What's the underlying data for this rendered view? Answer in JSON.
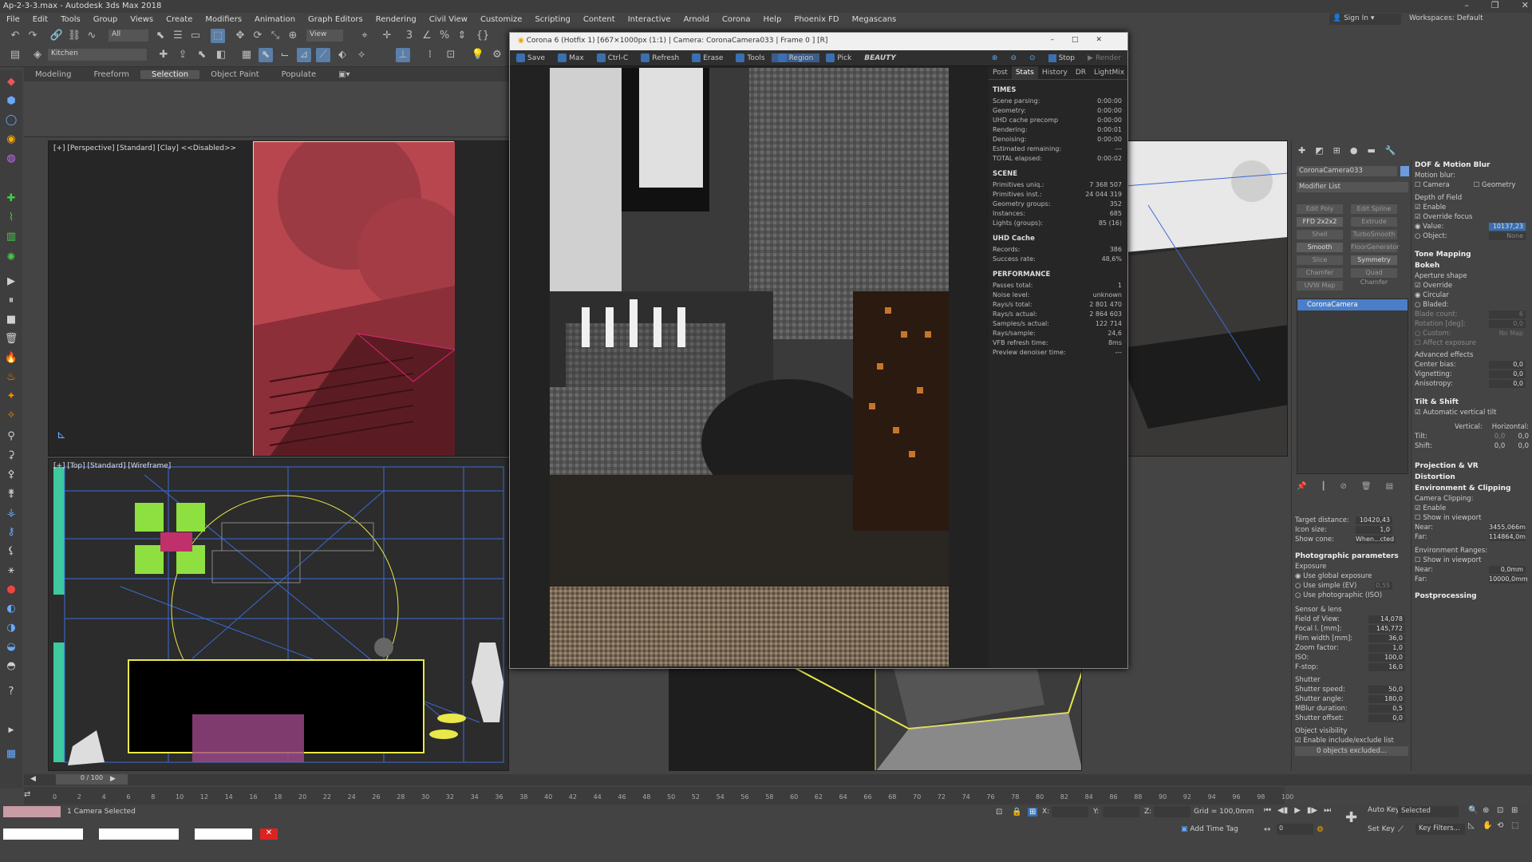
{
  "app": {
    "title": "Ap-2-3-3.max - Autodesk 3ds Max 2018",
    "signin": "Sign In",
    "workspaces_label": "Workspaces:",
    "workspace": "Default"
  },
  "menu": [
    "File",
    "Edit",
    "Tools",
    "Group",
    "Views",
    "Create",
    "Modifiers",
    "Animation",
    "Graph Editors",
    "Rendering",
    "Civil View",
    "Customize",
    "Scripting",
    "Content",
    "Interactive",
    "Arnold",
    "Corona",
    "Help",
    "Phoenix FD",
    "Megascans"
  ],
  "toolbar": {
    "selection_filter": "All",
    "view_dropdown": "View",
    "layer": "Kitchen"
  },
  "ribbon_tabs": [
    "Modeling",
    "Freeform",
    "Selection",
    "Object Paint",
    "Populate"
  ],
  "viewports": {
    "top_left": "[+] [Perspective] [Standard] [Clay] <<Disabled>>",
    "bottom_left": "[+] [Top] [Standard] [Wireframe]"
  },
  "vfb": {
    "title": "Corona 6 (Hotfix 1) [667×1000px (1:1) | Camera: CoronaCamera033 | Frame 0 ] [R]",
    "tools": [
      "Save",
      "Max",
      "Ctrl-C",
      "Refresh",
      "Erase",
      "Tools",
      "Region",
      "Pick"
    ],
    "channel": "BEAUTY",
    "stop": "Stop",
    "render": "Render",
    "tabs": [
      "Post",
      "Stats",
      "History",
      "DR",
      "LightMix"
    ],
    "stats": [
      {
        "heading": "TIMES",
        "rows": [
          [
            "Scene parsing:",
            "0:00:00"
          ],
          [
            "Geometry:",
            "0:00:00"
          ],
          [
            "UHD cache precomp",
            "0:00:00"
          ],
          [
            "Rendering:",
            "0:00:01"
          ],
          [
            "Denoising:",
            "0:00:00"
          ],
          [
            "Estimated remaining:",
            "---"
          ],
          [
            "TOTAL elapsed:",
            "0:00:02"
          ]
        ]
      },
      {
        "heading": "SCENE",
        "rows": [
          [
            "Primitives uniq.:",
            "7 368 507"
          ],
          [
            "Primitives inst.:",
            "24 044 319"
          ],
          [
            "Geometry groups:",
            "352"
          ],
          [
            "Instances:",
            "685"
          ],
          [
            "Lights (groups):",
            "85 (16)"
          ]
        ]
      },
      {
        "heading": "UHD Cache",
        "rows": [
          [
            "Records:",
            "386"
          ],
          [
            "Success rate:",
            "48,6%"
          ]
        ]
      },
      {
        "heading": "PERFORMANCE",
        "rows": [
          [
            "Passes total:",
            "1"
          ],
          [
            "Noise level:",
            "unknown"
          ],
          [
            "Rays/s total:",
            "2 801 470"
          ],
          [
            "Rays/s actual:",
            "2 864 603"
          ],
          [
            "Samples/s actual:",
            "122 714"
          ],
          [
            "Rays/sample:",
            "24,6"
          ],
          [
            "VFB refresh time:",
            "8ms"
          ],
          [
            "Preview denoiser time:",
            "---"
          ]
        ]
      }
    ]
  },
  "command_panel": {
    "object_name": "CoronaCamera033",
    "modifier_list": "Modifier List",
    "buttons": [
      "Edit Poly",
      "Edit Spline",
      "FFD 2x2x2",
      "Extrude",
      "Shell",
      "TurboSmooth",
      "Smooth",
      "FloorGenerator",
      "Slice",
      "Symmetry",
      "Chamfer",
      "Quad Chamfer",
      "UVW Map"
    ],
    "stack_item": "CoronaCamera",
    "target_distance_label": "Target distance:",
    "target_distance": "10420,43",
    "icon_size_label": "Icon size:",
    "icon_size": "1,0",
    "show_cone_label": "Show cone:",
    "show_cone": "When...cted",
    "photographic": "Photographic parameters",
    "exposure": "Exposure",
    "exposure_opts": [
      "Use global exposure",
      "Use simple (EV)",
      "Use photographic (ISO)"
    ],
    "ev_value": "0,55",
    "sensor": "Sensor & lens",
    "sensor_rows": [
      [
        "Field of View:",
        "14,078"
      ],
      [
        "Focal l. [mm]:",
        "145,772"
      ],
      [
        "Film width [mm]:",
        "36,0"
      ],
      [
        "Zoom factor:",
        "1,0"
      ],
      [
        "ISO:",
        "100,0"
      ],
      [
        "F-stop:",
        "16,0"
      ]
    ],
    "shutter": "Shutter",
    "shutter_rows": [
      [
        "Shutter speed:",
        "50,0"
      ],
      [
        "Shutter angle:",
        "180,0"
      ],
      [
        "MBlur duration:",
        "0,5"
      ],
      [
        "Shutter offset:",
        "0,0"
      ]
    ],
    "visibility": "Object visibility",
    "include_exclude": "Enable include/exclude list",
    "excluded": "0 objects excluded..."
  },
  "right_panel": {
    "dof_head": "DOF & Motion Blur",
    "motion_blur": "Motion blur:",
    "mb_opts": [
      "Camera",
      "Geometry"
    ],
    "dof": "Depth of Field",
    "dof_opts": [
      "Enable",
      "Override focus"
    ],
    "focus_value_label": "Value:",
    "focus_value": "10137,23",
    "focus_object_label": "Object:",
    "focus_object": "None",
    "tone_mapping": "Tone Mapping",
    "bokeh": "Bokeh",
    "aperture": "Aperture shape",
    "ap_opts": [
      "Override",
      "Circular",
      "Bladed:"
    ],
    "blade_count_label": "Blade count:",
    "blade_count": "6",
    "rotation_label": "Rotation [deg]:",
    "rotation": "0,0",
    "custom_label": "Custom:",
    "custom": "No Map",
    "affect_exposure": "Affect exposure",
    "advanced": "Advanced effects",
    "adv_rows": [
      [
        "Center bias:",
        "0,0"
      ],
      [
        "Vignetting:",
        "0,0"
      ],
      [
        "Anisotropy:",
        "0,0"
      ]
    ],
    "tilt_shift": "Tilt & Shift",
    "auto_tilt": "Automatic vertical tilt",
    "vertical": "Vertical:",
    "horizontal": "Horizontal:",
    "tilt_label": "Tilt:",
    "shift_label": "Shift:",
    "tilt_v": "0,0",
    "tilt_h": "0,0",
    "shift_v": "0,0",
    "shift_h": "0,0",
    "projection": "Projection & VR",
    "distortion": "Distortion",
    "env_clip": "Environment & Clipping",
    "cam_clip": "Camera Clipping:",
    "clip_opts": [
      "Enable",
      "Show in viewport"
    ],
    "near_label": "Near:",
    "near": "3455,066m",
    "far_label": "Far:",
    "far": "114864,0m",
    "env_ranges": "Environment Ranges:",
    "env_show": "Show in viewport",
    "env_near": "0,0mm",
    "env_far": "10000,0mm",
    "postprocessing": "Postprocessing"
  },
  "timeline": {
    "frame": "0 / 100",
    "ticks": [
      "0",
      "2",
      "4",
      "6",
      "8",
      "10",
      "12",
      "14",
      "16",
      "18",
      "20",
      "22",
      "24",
      "26",
      "28",
      "30",
      "32",
      "34",
      "36",
      "38",
      "40",
      "42",
      "44",
      "46",
      "48",
      "50",
      "52",
      "54",
      "56",
      "58",
      "60",
      "62",
      "64",
      "66",
      "68",
      "70",
      "72",
      "74",
      "76",
      "78",
      "80",
      "82",
      "84",
      "86",
      "88",
      "90",
      "92",
      "94",
      "96",
      "98",
      "100"
    ]
  },
  "status": {
    "selected": "1 Camera Selected",
    "x_label": "X:",
    "y_label": "Y:",
    "z_label": "Z:",
    "grid": "Grid = 100,0mm",
    "add_time_tag": "Add Time Tag",
    "auto_key": "Auto Key",
    "set_key": "Set Key",
    "selected_dd": "Selected",
    "key_filters": "Key Filters...",
    "frame_field": "0"
  },
  "colors": {
    "accent": "#5a7fa8",
    "selection_yellow": "#e8e84a",
    "clay_red": "#c04a55",
    "green_objects": "#8ee040"
  }
}
